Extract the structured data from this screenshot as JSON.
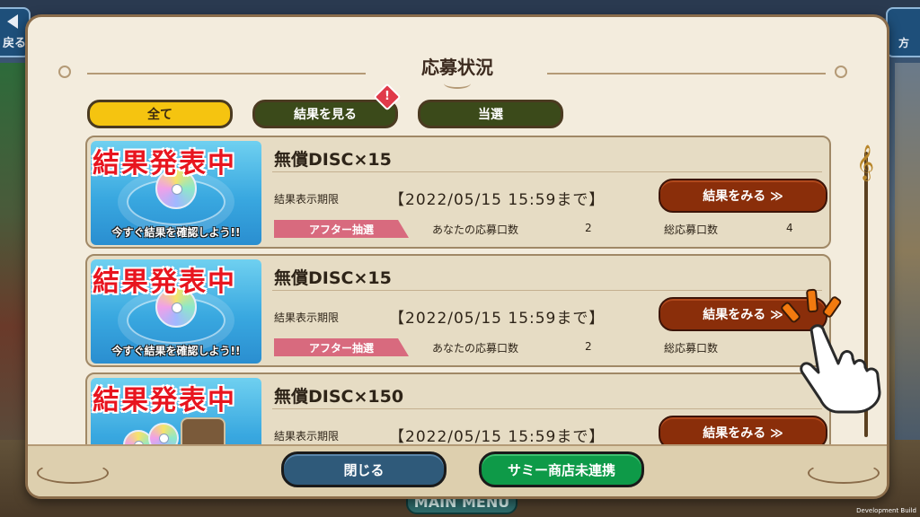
{
  "background": {
    "back_label": "戻る",
    "right_label": "方",
    "main_menu": "MAIN MENU",
    "dev_build": "Development Build"
  },
  "dialog": {
    "title": "応募状況",
    "tabs": [
      {
        "label": "全て",
        "active": true
      },
      {
        "label": "結果を見る",
        "active": false,
        "alert": "!"
      },
      {
        "label": "当選",
        "active": false
      }
    ],
    "entries": [
      {
        "banner": "結果発表中",
        "caption": "今すぐ結果を確認しよう!!",
        "name": "無償DISC×15",
        "period_label": "結果表示期限",
        "period_value": "【2022/05/15 15:59まで】",
        "button": "結果をみる ≫",
        "lottery_tag": "アフター抽選",
        "entries_label": "あなたの応募口数",
        "entries_value": "2",
        "total_label": "総応募口数",
        "total_value": "4"
      },
      {
        "banner": "結果発表中",
        "caption": "今すぐ結果を確認しよう!!",
        "name": "無償DISC×15",
        "period_label": "結果表示期限",
        "period_value": "【2022/05/15 15:59まで】",
        "button": "結果をみる ≫",
        "lottery_tag": "アフター抽選",
        "entries_label": "あなたの応募口数",
        "entries_value": "2",
        "total_label": "総応募口数",
        "total_value": ""
      },
      {
        "banner": "結果発表中",
        "name": "無償DISC×150",
        "period_label": "結果表示期限",
        "period_value": "【2022/05/15 15:59まで】",
        "button": "結果をみる ≫"
      }
    ],
    "footer": {
      "close": "閉じる",
      "link": "サミー商店未連携"
    }
  },
  "icons": {
    "scroll_knob": "treble-clef-icon",
    "pointer": "tap-hand-icon"
  },
  "colors": {
    "active_tab": "#f5c410",
    "inactive_tab": "#3b4a1a",
    "result_button": "#8a2e0a",
    "banner_text": "#e8151f",
    "close_button": "#2f5a7a",
    "link_button": "#0e9a48"
  }
}
